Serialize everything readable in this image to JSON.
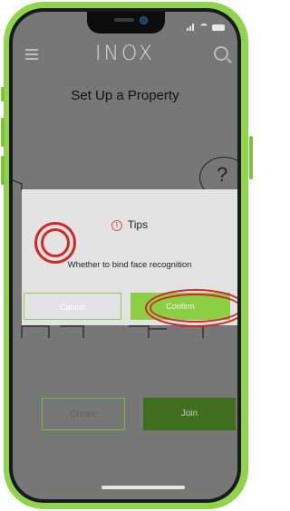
{
  "header": {
    "logo": "INOX"
  },
  "page": {
    "title": "Set Up a Property"
  },
  "illustration": {
    "bubble_text": "?"
  },
  "dialog": {
    "title": "Tips",
    "message": "Whether to bind face recognition",
    "cancel_label": "Cancel",
    "confirm_label": "Confirm"
  },
  "actions": {
    "create_label": "Create",
    "join_label": "Join"
  },
  "colors": {
    "accent": "#8ccf45",
    "join_button": "#3f6e1e",
    "annotation": "#d32828",
    "warning": "#e05252"
  }
}
